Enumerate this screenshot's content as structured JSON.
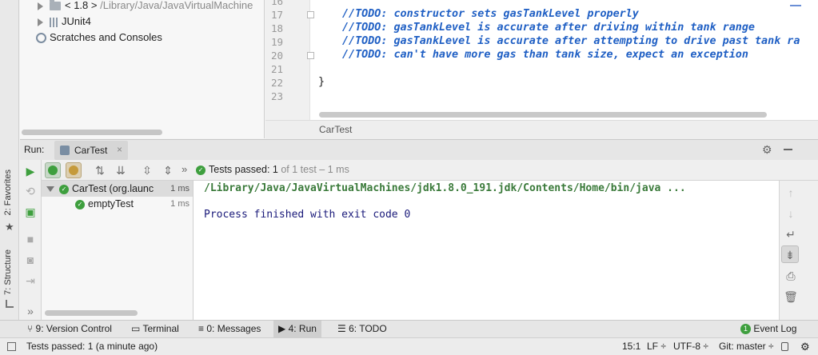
{
  "project_tree": {
    "items": [
      {
        "label": "< 1.8 >",
        "path": "/Library/Java/JavaVirtualMachine"
      },
      {
        "label": "JUnit4"
      },
      {
        "label": "Scratches and Consoles"
      }
    ]
  },
  "editor": {
    "lines": [
      {
        "num": "16",
        "text": ""
      },
      {
        "num": "17",
        "comment": "//",
        "todo": "TODO: constructor sets gasTankLevel properly"
      },
      {
        "num": "18",
        "comment": "//",
        "todo": "TODO: gasTankLevel is accurate after driving within tank range"
      },
      {
        "num": "19",
        "comment": "//",
        "todo": "TODO: gasTankLevel is accurate after attempting to drive past tank ran"
      },
      {
        "num": "20",
        "comment": "//",
        "todo": "TODO: can't have more gas than tank size, expect an exception"
      },
      {
        "num": "21",
        "text": ""
      },
      {
        "num": "22",
        "text": "}"
      },
      {
        "num": "23",
        "text": ""
      }
    ],
    "breadcrumb": "CarTest"
  },
  "run_window": {
    "label": "Run:",
    "tab": "CarTest",
    "close_glyph": "×",
    "status_prefix": "Tests passed:",
    "status_count": "1",
    "status_suffix": "of 1 test – 1 ms",
    "more_glyph": "»",
    "tree": [
      {
        "name": "CarTest (org.launc",
        "time": "1 ms"
      },
      {
        "name": "emptyTest",
        "time": "1 ms"
      }
    ],
    "console": [
      "/Library/Java/JavaVirtualMachines/jdk1.8.0_191.jdk/Contents/Home/bin/java ...",
      "Process finished with exit code 0"
    ]
  },
  "side_tabs": {
    "favorites": "2: Favorites",
    "structure": "7: Structure"
  },
  "bottom_tabs": {
    "version_control": "9: Version Control",
    "terminal": "Terminal",
    "messages": "0: Messages",
    "run": "4: Run",
    "todo": "6: TODO",
    "event_log": "Event Log",
    "event_count": "1"
  },
  "status_bar": {
    "message": "Tests passed: 1 (a minute ago)",
    "position": "15:1",
    "line_sep": "LF ÷",
    "encoding": "UTF-8 ÷",
    "git": "Git: master ÷"
  },
  "colors": {
    "accent_green": "#3e9f3e",
    "todo_blue": "#1f5fc4",
    "console_text": "#1a1a7a"
  }
}
